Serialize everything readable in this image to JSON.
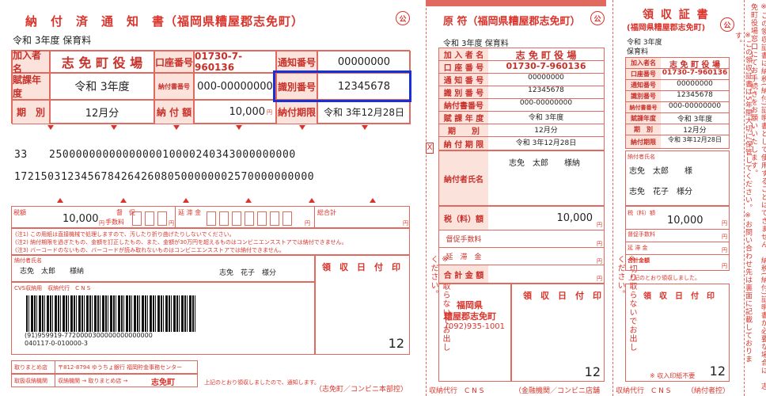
{
  "slip1": {
    "title": "納　付　済　通　知　書（福岡県糟屋郡志免町）",
    "koin": "公",
    "year_line": "令和 3年度 保育料",
    "lbl_kanyusha": "加入者名",
    "kanyusha": "志 免 町 役 場",
    "lbl_koza": "口座番号",
    "koza": "01730-7-960136",
    "lbl_tsuchi": "通知番号",
    "tsuchi": "00000000",
    "lbl_nendo": "賦課年度",
    "nendo": "令和 3年度",
    "lbl_nofusho": "納付書番号",
    "nofusho": "000-00000000",
    "lbl_shikibetsu": "識別番号",
    "shikibetsu": "12345678",
    "lbl_kibetsu": "期　別",
    "kibetsu": "12月分",
    "lbl_nofugaku": "納 付 額",
    "nofugaku": "10,000",
    "yen": "円",
    "lbl_kigen": "納付期限",
    "kigen": "令和 3年12月28日",
    "barcode1": "33　　2500000000000000010000240343000000000",
    "barcode2": "172150312345678426426080500000002570000000000",
    "lbl_zeigaku": "税額",
    "zeigaku": "10,000",
    "lbl_tokusoku": "督　促",
    "lbl_tesuryo": "手数料",
    "lbl_entai": "延 滞 金",
    "lbl_gokei": "総合計",
    "notes": [
      "(注1) この用紙は直接機械で処理しますので、汚したり折り曲げたりしないでください。",
      "(注2) 納付期限を過ぎたもの、金額を訂正したもの、また、金額が30万円を超えるものはコンビニエンスストアでは納付できません。",
      "(注3) バーコードのないもの、バーコードが読み取れないものはコンビニエンスストアでは納付できません。"
    ],
    "lbl_nofusha": "納付者氏名",
    "nofusha1": "志免　太郎　　様納",
    "nofusha2": "志免　花子　様分",
    "lbl_ryoshu": "領　収　日　付　印",
    "cvs_label": "CVS収納用　収納代行　C N S",
    "barcode_text": "(91)959919-7720000300000000000000",
    "barcode_text2": "040117-0-010000-3",
    "stamp_num": "12",
    "lbl_torimatome": "取りまとめ店",
    "torimatome": "〒812-8794 ゆうちょ銀行 福岡貯金事務センター",
    "lbl_toriatsukai": "取扱収納機関",
    "toriatsukai": "収納機関 → 取りまとめ店 →",
    "shime": "志免町",
    "footer_note": "上記のとおり領収しましたので、通知します。",
    "footer_right": "（志免町／コンビニ本部控）"
  },
  "slip2": {
    "title": "原 符（福岡県糟屋郡志免町）",
    "koin": "公",
    "year_line": "令和 3年度 保育料",
    "rows": [
      {
        "label": "加 入 者 名",
        "value": "志 免 町 役 場"
      },
      {
        "label": "口 座 番 号",
        "value": "01730-7-960136"
      },
      {
        "label": "通 知 番 号",
        "value": "00000000"
      },
      {
        "label": "識 別 番 号",
        "value": "12345678"
      },
      {
        "label": "納付書番号",
        "value": "000-00000000"
      },
      {
        "label": "賦 課 年 度",
        "value": "令和 3年度"
      },
      {
        "label": "期　　別",
        "value": "12月分"
      },
      {
        "label": "納 付 期 限",
        "value": "令和 3年12月28日"
      }
    ],
    "x_mark": "X",
    "lbl_nofusha": "納付者氏名",
    "nofusha": "志免　太郎　　様納",
    "lbl_zei": "税（料）額",
    "zei": "10,000",
    "yen": "円",
    "lbl_tokusoku": "督促手数料",
    "lbl_entai": "延　滞　金",
    "lbl_gokei": "合 計 金 額",
    "vert_left": "※切り取らないでお出しください。",
    "vert_right": "※切り取らないでお出しください。",
    "office1": "福岡県",
    "office2": "糟屋郡志免町",
    "tel": "(092)935-1001",
    "lbl_ryoshu": "領　収　日　付　印",
    "stamp_num": "12",
    "footer_left": "収納代行　C N S",
    "footer_right": "（金融機関／コンビニ店舗控）"
  },
  "slip3": {
    "title": "領 収 証 書",
    "subtitle": "(福岡県糟屋郡志免町)",
    "koin": "公",
    "year_line": "令和 3年度",
    "year_line2": "保育料",
    "rows": [
      {
        "label": "加入者名",
        "value": "志 免 町 役 場"
      },
      {
        "label": "口座番号",
        "value": "01730-7-960136"
      },
      {
        "label": "通知番号",
        "value": "00000000"
      },
      {
        "label": "識別番号",
        "value": "12345678"
      },
      {
        "label": "納付書番号",
        "value": "000-00000000"
      },
      {
        "label": "賦課年度",
        "value": "令和 3年度"
      },
      {
        "label": "期　別",
        "value": "12月分"
      },
      {
        "label": "納付期限",
        "value": "令和 3年12月28日"
      }
    ],
    "lbl_nofusha": "納付者氏名",
    "nofusha1": "志免　太郎　　様",
    "nofusha2": "志免　花子　様分",
    "lbl_zei": "税（料）額",
    "zei": "10,000",
    "yen": "円",
    "lbl_tokusoku": "督促手数料",
    "lbl_entai": "延 滞 金",
    "lbl_gokei": "合計金額",
    "note_received": "上記のとおり領収しました。",
    "lbl_ryoshu": "領　収　日　付　印",
    "stamp_note": "※ 収入印紙不要",
    "stamp_num": "12",
    "footer_left": "収納代行　C N S",
    "footer_right": "（納付者控）",
    "vert_mid": "※この領収証書は5年間大切に保管してください。※お問い合わせ先は裏面に記載しております。",
    "vert_far": "※この領収証書は納税(納付)証明書として使用することはできません。納税(納付)証明書が必要な場合は、志免町役場窓口にてお手続きをお願いいたします。"
  }
}
